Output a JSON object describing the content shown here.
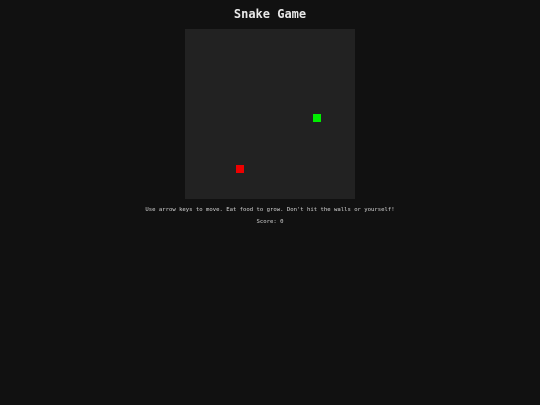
{
  "title": "Snake Game",
  "instructions": "Use arrow keys to move. Eat food to grow. Don't hit the walls or yourself!",
  "score_label": "Score",
  "score": 0,
  "score_text": "Score: 0",
  "board": {
    "grid_size": 20,
    "background_color": "#222222",
    "snake": {
      "color": "#00ee00",
      "segments": [
        {
          "col": 15,
          "row": 10
        }
      ]
    },
    "food": {
      "color": "#ee0000",
      "col": 6,
      "row": 16
    }
  }
}
